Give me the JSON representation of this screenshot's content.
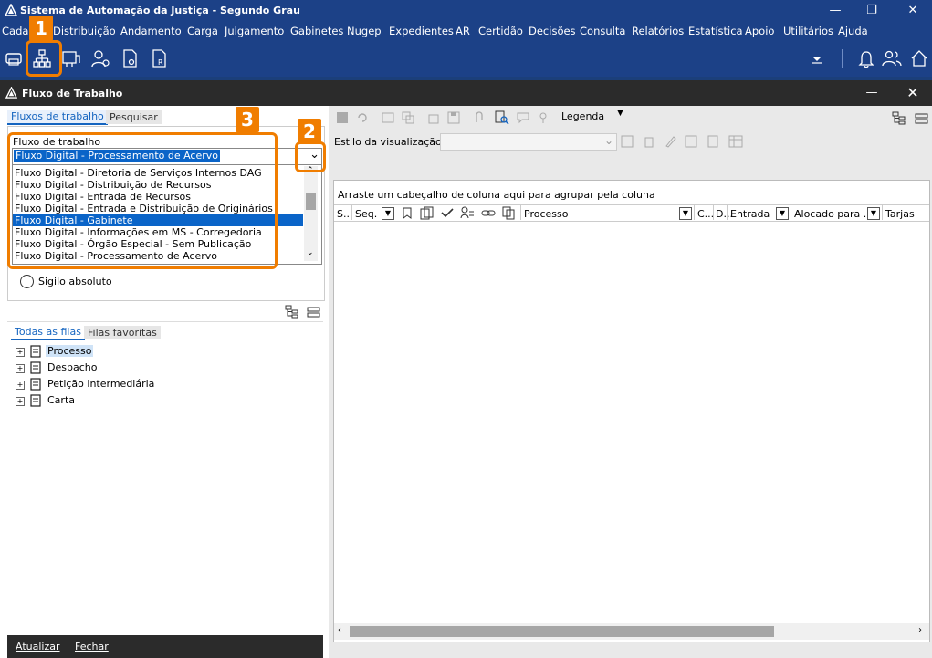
{
  "window": {
    "title": "Sistema de Automação da Justiça - Segundo Grau"
  },
  "menu": [
    "Cadastro",
    "Distribuição",
    "Andamento",
    "Carga",
    "Julgamento",
    "Gabinetes",
    "Nugep",
    "Expedientes",
    "AR",
    "Certidão",
    "Decisões",
    "Consulta",
    "Relatórios",
    "Estatística",
    "Apoio",
    "Utilitários",
    "Ajuda"
  ],
  "menu_visible_first": "Cada",
  "subwindow": {
    "title": "Fluxo de Trabalho"
  },
  "left": {
    "tabs": [
      "Fluxos de trabalho",
      "Pesquisar"
    ],
    "fluxo_label": "Fluxo de trabalho",
    "fluxo_value": "Fluxo Digital - Processamento de Acervo",
    "dropdown_items": [
      "Fluxo Digital - Diretoria de Serviços Internos DAG",
      "Fluxo Digital - Distribuição de Recursos",
      "Fluxo Digital - Entrada de Recursos",
      "Fluxo Digital - Entrada e Distribuição de Originários",
      "Fluxo Digital - Gabinete",
      "Fluxo Digital - Informações em MS - Corregedoria",
      "Fluxo Digital - Órgão Especial - Sem Publicação",
      "Fluxo Digital - Processamento de Acervo"
    ],
    "selected_index": 4,
    "sigilo_label": "Sigilo absoluto",
    "queue_tabs": [
      "Todas as filas",
      "Filas favoritas"
    ],
    "tree": [
      "Processo",
      "Despacho",
      "Petição intermediária",
      "Carta"
    ],
    "footer": {
      "atualizar": "Atualizar",
      "fechar": "Fechar"
    }
  },
  "right": {
    "legenda": "Legenda",
    "estilo_label": "Estilo da visualização",
    "group_hint": "Arraste um cabeçalho de coluna aqui para agrupar pela coluna",
    "columns": [
      "S...",
      "Seq.",
      "Processo",
      "C...",
      "D...",
      "Entrada",
      "Alocado para ...",
      "Tarjas"
    ]
  },
  "callouts": [
    "1",
    "2",
    "3"
  ],
  "colors": {
    "accent": "#f07d00",
    "titlebar": "#1c4187",
    "selection": "#0a64c8"
  }
}
